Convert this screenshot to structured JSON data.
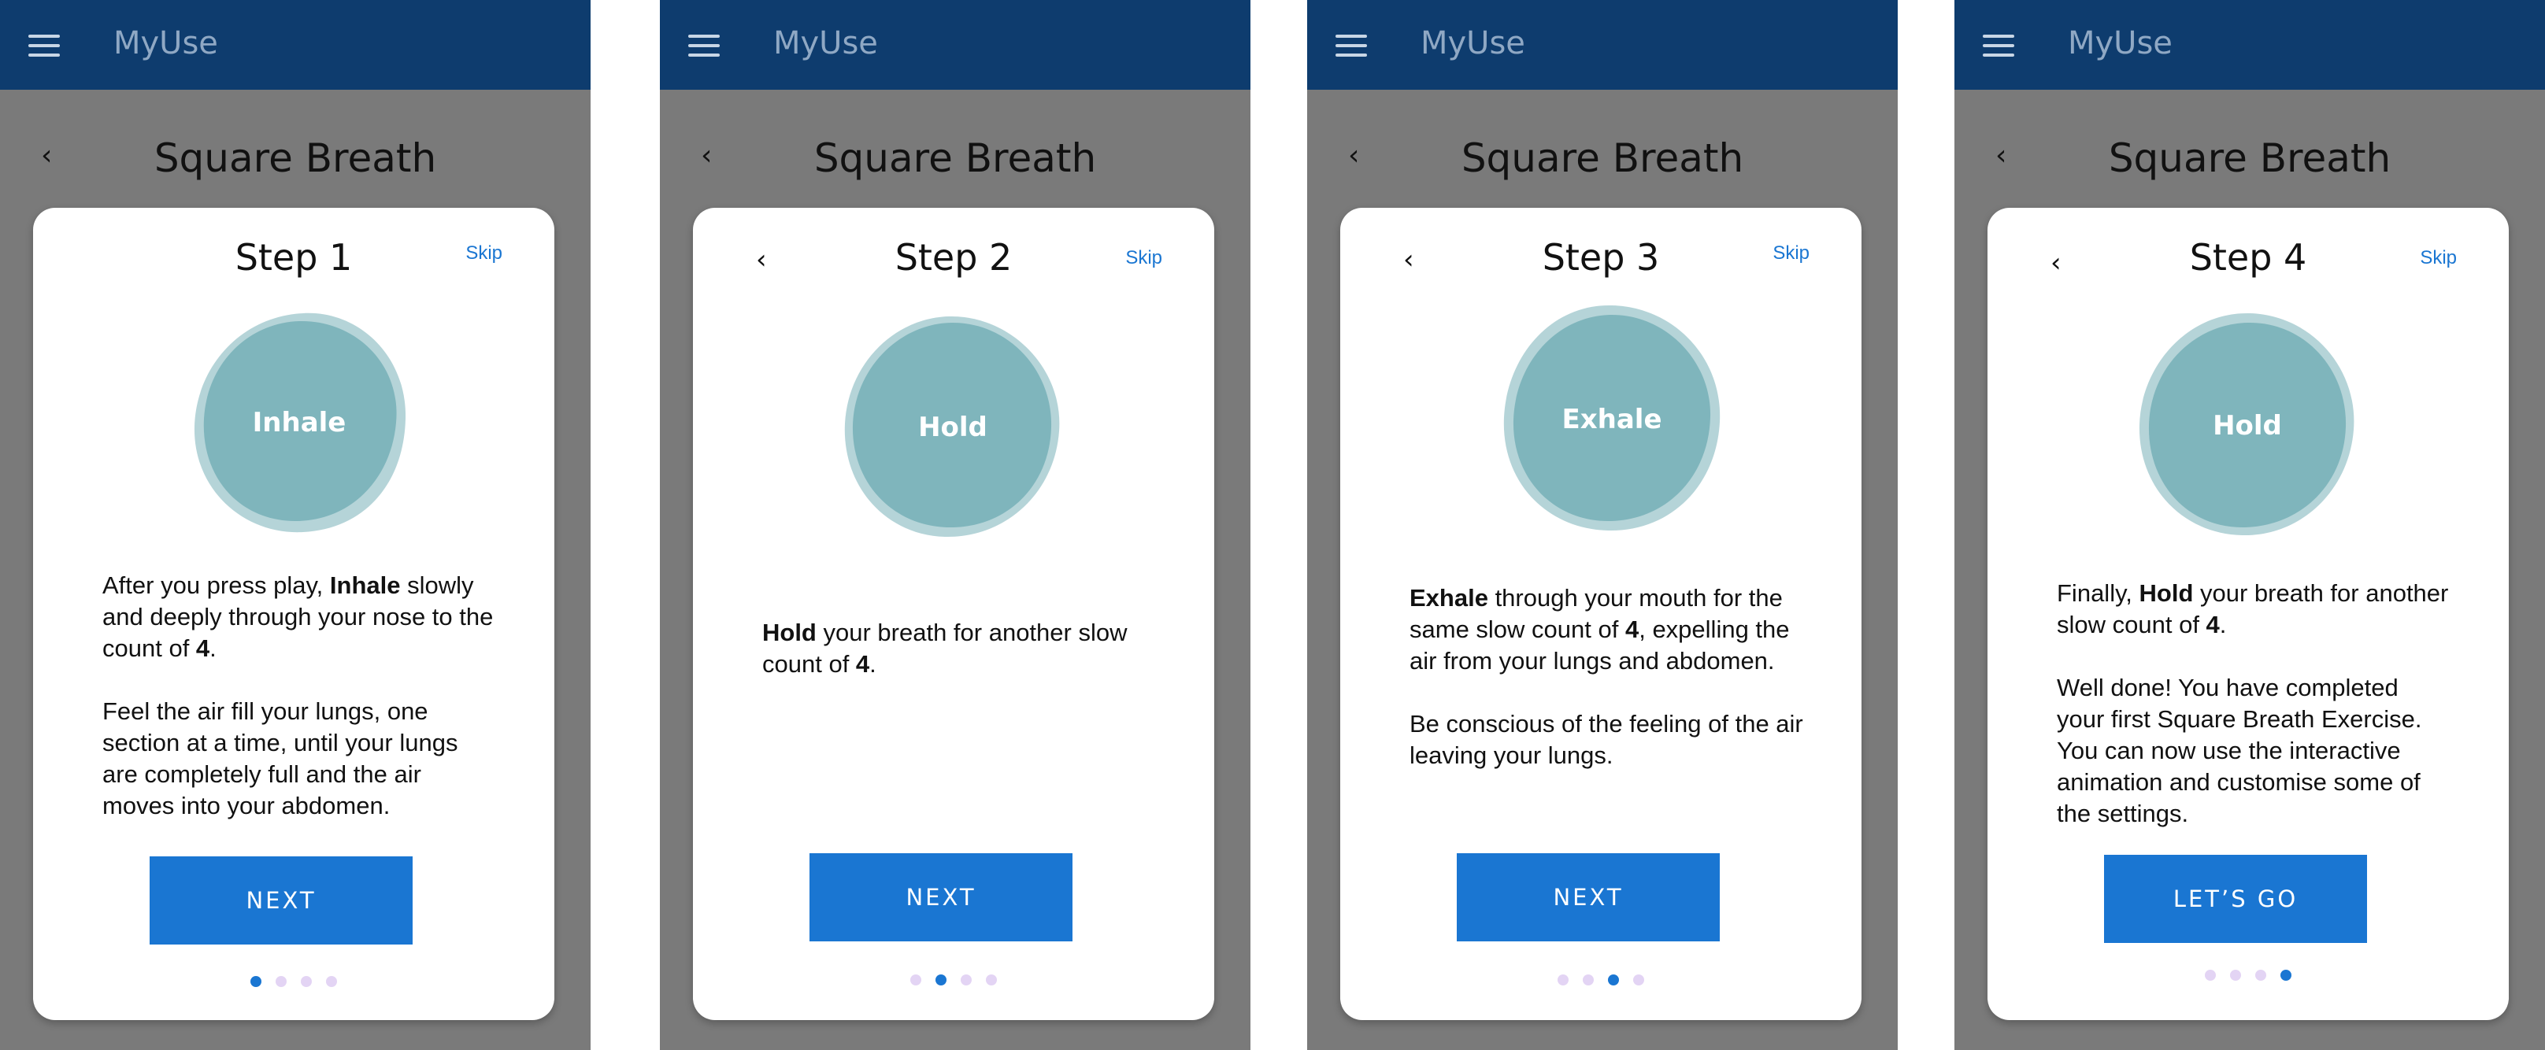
{
  "app": {
    "title": "MyUse",
    "menu_icon": "menu-icon"
  },
  "colors": {
    "appbar": "#0e3c6e",
    "accent": "#1a76d2",
    "blob": "#7fb5bc",
    "dot_inactive": "#e3d4f4"
  },
  "screens": [
    {
      "page_title": "Square Breath",
      "step_title": "Step 1",
      "skip": "Skip",
      "has_card_back": false,
      "blob_label": "Inhale",
      "paragraphs": [
        [
          {
            "t": "After you press play, ",
            "b": false
          },
          {
            "t": "Inhale",
            "b": true
          },
          {
            "t": " slowly and deeply through your nose to the count of ",
            "b": false
          },
          {
            "t": "4",
            "b": true
          },
          {
            "t": ".",
            "b": false
          }
        ],
        [
          {
            "t": "Feel the air fill your lungs, one section at a time, until your lungs are completely full and the air moves into your abdomen.",
            "b": false
          }
        ]
      ],
      "button": "NEXT",
      "active_dot": 0
    },
    {
      "page_title": "Square Breath",
      "step_title": "Step 2",
      "skip": "Skip",
      "has_card_back": true,
      "blob_label": "Hold",
      "paragraphs": [
        [
          {
            "t": "Hold",
            "b": true
          },
          {
            "t": " your breath for another slow count of ",
            "b": false
          },
          {
            "t": "4",
            "b": true
          },
          {
            "t": ".",
            "b": false
          }
        ]
      ],
      "button": "NEXT",
      "active_dot": 1
    },
    {
      "page_title": "Square Breath",
      "step_title": "Step 3",
      "skip": "Skip",
      "has_card_back": true,
      "blob_label": "Exhale",
      "paragraphs": [
        [
          {
            "t": "Exhale",
            "b": true
          },
          {
            "t": " through your mouth for the same slow count of ",
            "b": false
          },
          {
            "t": "4",
            "b": true
          },
          {
            "t": ", expelling the air from your lungs and abdomen.",
            "b": false
          }
        ],
        [
          {
            "t": "Be conscious of the feeling of the air leaving your lungs.",
            "b": false
          }
        ]
      ],
      "button": "NEXT",
      "active_dot": 2
    },
    {
      "page_title": "Square Breath",
      "step_title": "Step 4",
      "skip": "Skip",
      "has_card_back": true,
      "blob_label": "Hold",
      "paragraphs": [
        [
          {
            "t": "Finally, ",
            "b": false
          },
          {
            "t": "Hold",
            "b": true
          },
          {
            "t": " your breath for another slow count of ",
            "b": false
          },
          {
            "t": "4",
            "b": true
          },
          {
            "t": ".",
            "b": false
          }
        ],
        [
          {
            "t": "Well done! You have completed your first Square Breath Exercise. You can now use the interactive animation and customise some of the settings.",
            "b": false
          }
        ]
      ],
      "button": "LET’S GO",
      "active_dot": 3
    }
  ]
}
